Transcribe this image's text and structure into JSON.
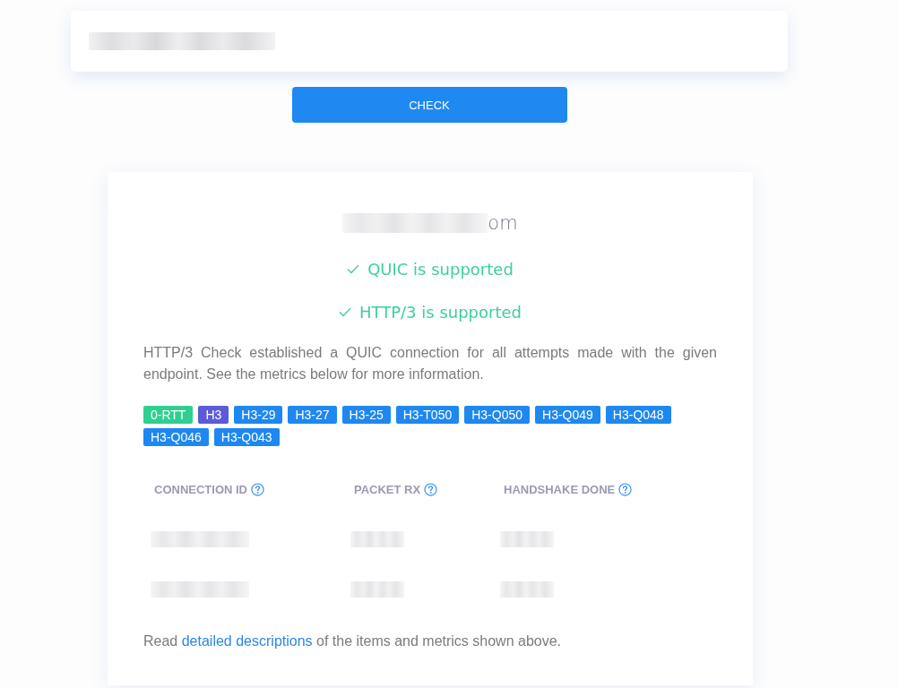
{
  "url_field": {
    "value_blurred": true
  },
  "check_button": {
    "label": "CHECK"
  },
  "result": {
    "host": {
      "blurred_part": true,
      "visible_end": "om"
    },
    "checks": [
      {
        "ok": true,
        "text": "QUIC is supported"
      },
      {
        "ok": true,
        "text": "HTTP/3 is supported"
      }
    ],
    "summary": "HTTP/3 Check established a QUIC connection for all attempts made with the given endpoint. See the metrics below for more information.",
    "tags": [
      {
        "label": "0-RTT",
        "color": "#2fcf91"
      },
      {
        "label": "H3",
        "color": "#5c5ad8"
      },
      {
        "label": "H3-29",
        "color": "#1e88f0"
      },
      {
        "label": "H3-27",
        "color": "#1e88f0"
      },
      {
        "label": "H3-25",
        "color": "#1e88f0"
      },
      {
        "label": "H3-T050",
        "color": "#1e88f0"
      },
      {
        "label": "H3-Q050",
        "color": "#1e88f0"
      },
      {
        "label": "H3-Q049",
        "color": "#1e88f0"
      },
      {
        "label": "H3-Q048",
        "color": "#1e88f0"
      },
      {
        "label": "H3-Q046",
        "color": "#1e88f0"
      },
      {
        "label": "H3-Q043",
        "color": "#1e88f0"
      }
    ],
    "table": {
      "columns": [
        {
          "label": "CONNECTION ID",
          "help": true
        },
        {
          "label": "PACKET RX",
          "help": true
        },
        {
          "label": "HANDSHAKE DONE",
          "help": true
        }
      ],
      "rows": [
        {
          "cells": [
            {
              "blurred": true
            },
            {
              "blurred": true
            },
            {
              "blurred": true
            }
          ]
        },
        {
          "cells": [
            {
              "blurred": true
            },
            {
              "blurred": true
            },
            {
              "blurred": true
            }
          ]
        }
      ]
    },
    "footer": {
      "before": "Read",
      "link": "detailed descriptions",
      "after": "of the items and metrics shown above."
    }
  }
}
